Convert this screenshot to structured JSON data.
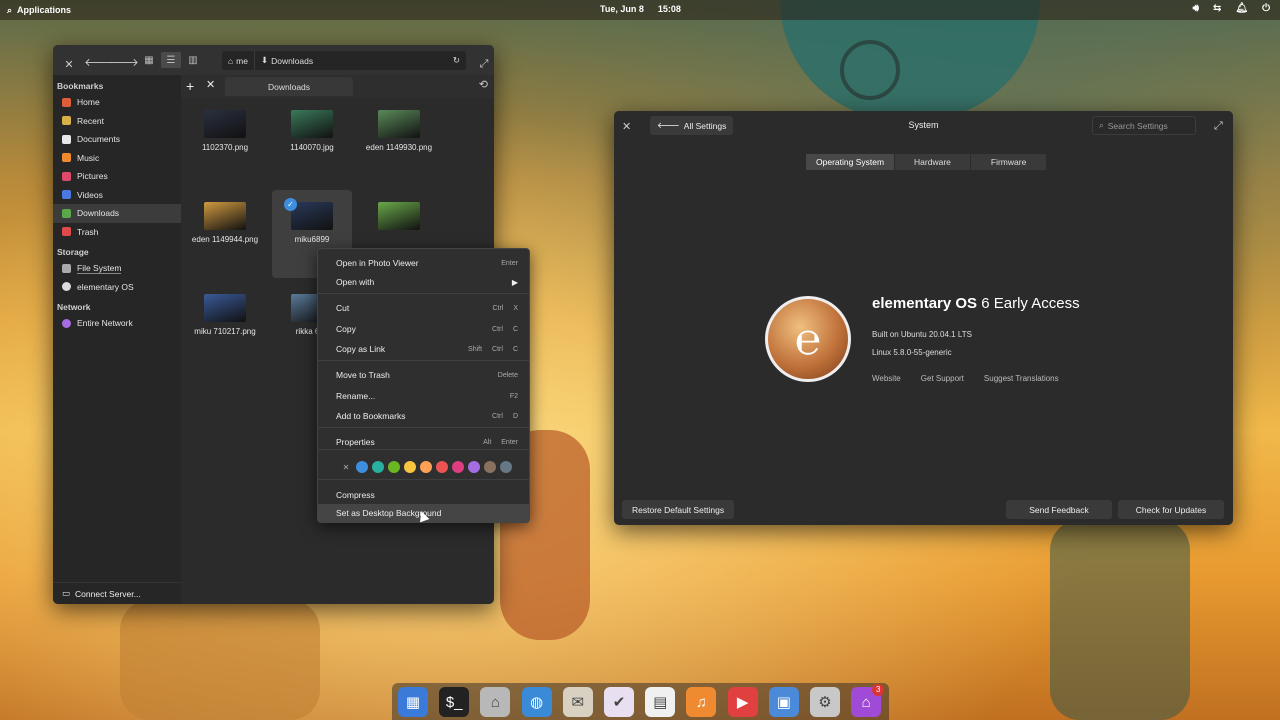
{
  "panel": {
    "applications": "Applications",
    "date": "Tue, Jun 8",
    "time": "15:08"
  },
  "files": {
    "path": {
      "home": "me",
      "folder": "Downloads"
    },
    "tab": "Downloads",
    "sidebar": {
      "bookmarks_heading": "Bookmarks",
      "bookmarks": [
        {
          "label": "Home",
          "color": "#e05c3a"
        },
        {
          "label": "Recent",
          "color": "#d8b04a"
        },
        {
          "label": "Documents",
          "color": "#e8e8e8"
        },
        {
          "label": "Music",
          "color": "#f08a30"
        },
        {
          "label": "Pictures",
          "color": "#e04a6a"
        },
        {
          "label": "Videos",
          "color": "#4a7ae0"
        },
        {
          "label": "Downloads",
          "color": "#5aa84a"
        },
        {
          "label": "Trash",
          "color": "#e04a4a"
        }
      ],
      "storage_heading": "Storage",
      "storage": [
        {
          "label": "File System"
        },
        {
          "label": "elementary OS"
        }
      ],
      "network_heading": "Network",
      "network": [
        {
          "label": "Entire Network"
        }
      ],
      "connect": "Connect Server..."
    },
    "grid": [
      {
        "name": "1102370.png",
        "color": "#2a3040"
      },
      {
        "name": "1140070.jpg",
        "color": "#3a7a5a"
      },
      {
        "name": "eden 1149930.png",
        "color": "#5a8a5a"
      },
      {
        "name": "eden 1149944.png",
        "color": "#d09a40"
      },
      {
        "name": "miku6899",
        "color": "#2a3a5a"
      },
      {
        "name": "",
        "color": "#6aa84a"
      },
      {
        "name": "miku 710217.png",
        "color": "#3a5a9a"
      },
      {
        "name": "rikka 642",
        "color": "#5a7a9a"
      }
    ]
  },
  "context_menu": {
    "items": [
      {
        "label": "Open in Photo Viewer",
        "accel": [
          "Enter"
        ]
      },
      {
        "label": "Open with",
        "accel": [
          "▶"
        ]
      },
      {
        "label": "Cut",
        "accel": [
          "Ctrl",
          "X"
        ]
      },
      {
        "label": "Copy",
        "accel": [
          "Ctrl",
          "C"
        ]
      },
      {
        "label": "Copy as Link",
        "accel": [
          "Shift",
          "Ctrl",
          "C"
        ]
      },
      {
        "label": "Move to Trash",
        "accel": [
          "Delete"
        ]
      },
      {
        "label": "Rename...",
        "accel": [
          "F2"
        ]
      },
      {
        "label": "Add to Bookmarks",
        "accel": [
          "Ctrl",
          "D"
        ]
      },
      {
        "label": "Properties",
        "accel": [
          "Alt",
          "Enter"
        ]
      },
      {
        "label": "Compress",
        "accel": []
      },
      {
        "label": "Set as Desktop Background",
        "accel": []
      }
    ],
    "tag_colors": [
      "#3d8ede",
      "#28b0a0",
      "#68b723",
      "#f9c440",
      "#ffa154",
      "#ed5353",
      "#de3e80",
      "#a56de2",
      "#8a715e",
      "#667885"
    ]
  },
  "system": {
    "back": "All Settings",
    "title": "System",
    "search_placeholder": "Search Settings",
    "tabs": [
      "Operating System",
      "Hardware",
      "Firmware"
    ],
    "os_name_bold": "elementary OS",
    "os_name_rest": " 6 Early Access",
    "built_on": "Built on Ubuntu 20.04.1 LTS",
    "kernel": "Linux 5.8.0-55-generic",
    "links": [
      "Website",
      "Get Support",
      "Suggest Translations"
    ],
    "restore": "Restore Default Settings",
    "feedback": "Send Feedback",
    "updates": "Check for Updates"
  },
  "dock": {
    "items": [
      {
        "name": "multitasking-view",
        "color": "#3a7ad8",
        "glyph": "▦"
      },
      {
        "name": "terminal",
        "color": "#222222",
        "glyph": "$_"
      },
      {
        "name": "files",
        "color": "#b8b8b8",
        "glyph": "⌂"
      },
      {
        "name": "web-browser",
        "color": "#3a8ad8",
        "glyph": "◍"
      },
      {
        "name": "mail",
        "color": "#d8d0c0",
        "glyph": "✉"
      },
      {
        "name": "tasks",
        "color": "#e8e0f0",
        "glyph": "✔"
      },
      {
        "name": "calendar",
        "color": "#f0f0f0",
        "glyph": "▤"
      },
      {
        "name": "music",
        "color": "#f08a30",
        "glyph": "♫"
      },
      {
        "name": "videos",
        "color": "#e04040",
        "glyph": "▶"
      },
      {
        "name": "photos",
        "color": "#4a8ad8",
        "glyph": "▣"
      },
      {
        "name": "system-settings",
        "color": "#c8c8c8",
        "glyph": "⚙"
      },
      {
        "name": "appcenter",
        "color": "#a04ad8",
        "glyph": "⌂",
        "badge": "3"
      }
    ]
  }
}
